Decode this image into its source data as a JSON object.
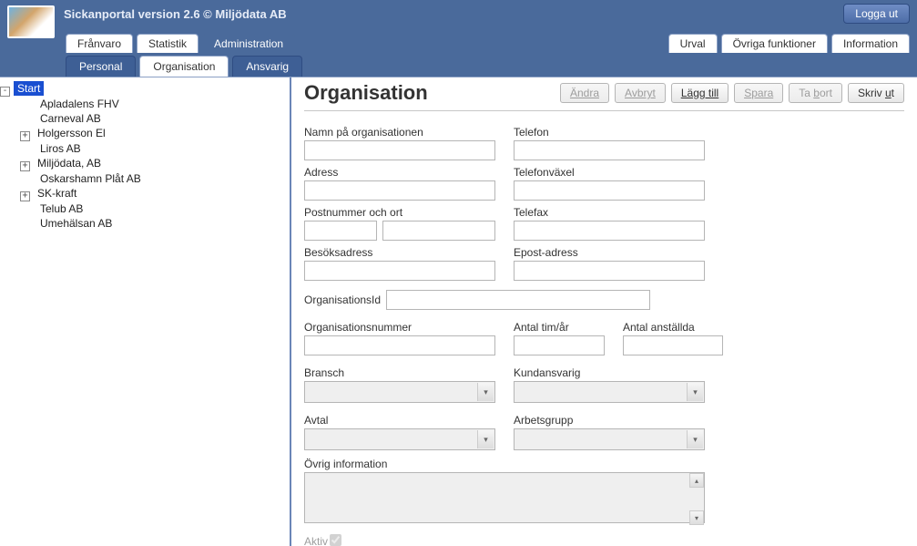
{
  "app": {
    "title": "Sickanportal version 2.6   © Miljödata AB",
    "logout": "Logga ut"
  },
  "mainTabs": {
    "left": [
      {
        "label": "Frånvaro",
        "name": "tab-franvaro",
        "active": false
      },
      {
        "label": "Statistik",
        "name": "tab-statistik",
        "active": false
      },
      {
        "label": "Administration",
        "name": "tab-administration",
        "active": true
      }
    ],
    "right": [
      {
        "label": "Urval",
        "name": "tab-urval"
      },
      {
        "label": "Övriga funktioner",
        "name": "tab-ovriga"
      },
      {
        "label": "Information",
        "name": "tab-information"
      }
    ]
  },
  "subTabs": [
    {
      "label": "Personal",
      "name": "subtab-personal",
      "active": false
    },
    {
      "label": "Organisation",
      "name": "subtab-organisation",
      "active": true
    },
    {
      "label": "Ansvarig",
      "name": "subtab-ansvarig",
      "active": false
    }
  ],
  "tree": {
    "rootLabel": "Start",
    "rootExpanded": true,
    "children": [
      {
        "label": "Apladalens FHV",
        "expandable": false
      },
      {
        "label": "Carneval AB",
        "expandable": false
      },
      {
        "label": "Holgersson El",
        "expandable": true
      },
      {
        "label": "Liros AB",
        "expandable": false
      },
      {
        "label": "Miljödata, AB",
        "expandable": true
      },
      {
        "label": "Oskarshamn Plåt AB",
        "expandable": false
      },
      {
        "label": "SK-kraft",
        "expandable": true
      },
      {
        "label": "Telub AB",
        "expandable": false
      },
      {
        "label": "Umehälsan AB",
        "expandable": false
      }
    ]
  },
  "form": {
    "title": "Organisation",
    "actions": {
      "edit": "Ändra",
      "cancel": "Avbryt",
      "add": "Lägg till",
      "save": "Spara",
      "delete": "Ta bort",
      "print": "Skriv ut"
    },
    "labels": {
      "orgName": "Namn på organisationen",
      "phone": "Telefon",
      "address": "Adress",
      "switchboard": "Telefonväxel",
      "postcodeCity": "Postnummer och ort",
      "fax": "Telefax",
      "visitAddress": "Besöksadress",
      "email": "Epost-adress",
      "orgId": "OrganisationsId",
      "orgNumber": "Organisationsnummer",
      "hoursPerYear": "Antal tim/år",
      "employees": "Antal anställda",
      "industry": "Bransch",
      "accountManager": "Kundansvarig",
      "contract": "Avtal",
      "workgroup": "Arbetsgrupp",
      "otherInfo": "Övrig information",
      "active": "Aktiv"
    },
    "values": {
      "orgName": "",
      "phone": "",
      "address": "",
      "switchboard": "",
      "postcode": "",
      "city": "",
      "fax": "",
      "visitAddress": "",
      "email": "",
      "orgId": "",
      "orgNumber": "",
      "hoursPerYear": "",
      "employees": "",
      "industry": "",
      "accountManager": "",
      "contract": "",
      "workgroup": "",
      "otherInfo": "",
      "active": true
    }
  }
}
